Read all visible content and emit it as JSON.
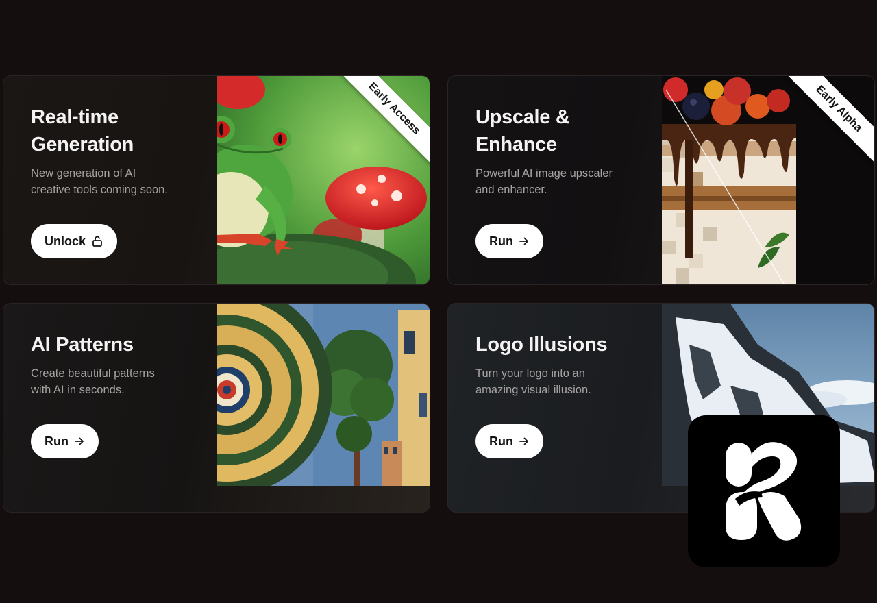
{
  "cards": [
    {
      "title_line1": "Real-time",
      "title_line2": "Generation",
      "description_line1": "New generation of AI",
      "description_line2": "creative tools coming soon.",
      "button_label": "Unlock",
      "button_icon": "lock-open-icon",
      "ribbon": "Early Access",
      "image": "frog-on-mushroom-illustration"
    },
    {
      "title_line1": "Upscale &",
      "title_line2": "Enhance",
      "description_line1": "Powerful AI image upscaler",
      "description_line2": "and enhancer.",
      "button_label": "Run",
      "button_icon": "arrow-right-icon",
      "ribbon": "Early Alpha",
      "image": "pixelated-vs-sharp-cake-comparison"
    },
    {
      "title_line1": "AI Patterns",
      "description_line1": "Create beautiful patterns",
      "description_line2": "with AI in seconds.",
      "button_label": "Run",
      "button_icon": "arrow-right-icon",
      "image": "spiral-pattern-town-illustration"
    },
    {
      "title_line1": "Logo Illusions",
      "description_line1": "Turn your logo into an",
      "description_line2": "amazing visual illusion.",
      "button_label": "Run",
      "button_icon": "arrow-right-icon",
      "image": "snowy-mountain-logo-illusion"
    }
  ],
  "app_logo": "krea-logo-icon",
  "colors": {
    "background": "#140e0e",
    "card_border": "#2a2426",
    "button_bg": "#ffffff",
    "title_text": "#f4f2f2",
    "desc_text": "#a8a3a3"
  }
}
